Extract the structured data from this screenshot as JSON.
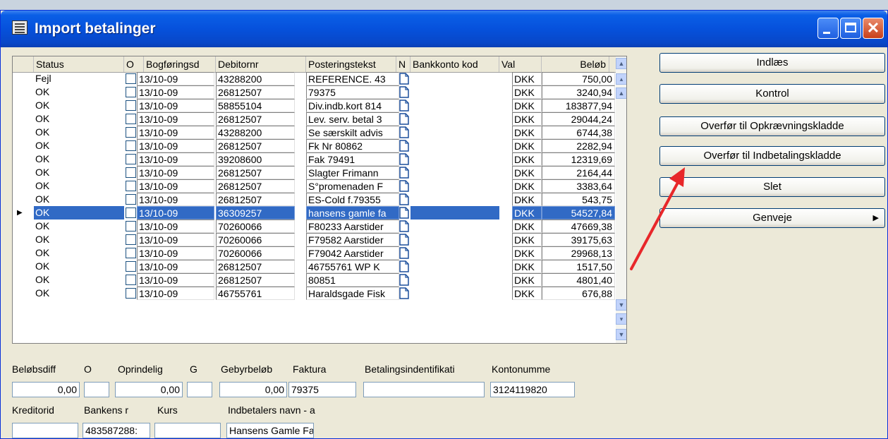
{
  "window": {
    "title": "Import betalinger"
  },
  "grid": {
    "columns": [
      "Status",
      "O",
      "Bogføringsd",
      "Debitornr",
      "Posteringstekst",
      "N",
      "Bankkonto kod",
      "Val",
      "Beløb"
    ],
    "rows": [
      {
        "status": "Fejl",
        "date": "13/10-09",
        "debitor": "43288200",
        "text": "REFERENCE. 43",
        "val": "DKK",
        "amount": "750,00"
      },
      {
        "status": "OK",
        "date": "13/10-09",
        "debitor": "26812507",
        "text": "79375",
        "val": "DKK",
        "amount": "3240,94"
      },
      {
        "status": "OK",
        "date": "13/10-09",
        "debitor": "58855104",
        "text": "Div.indb.kort 814",
        "val": "DKK",
        "amount": "183877,94"
      },
      {
        "status": "OK",
        "date": "13/10-09",
        "debitor": "26812507",
        "text": "Lev. serv. betal 3",
        "val": "DKK",
        "amount": "29044,24"
      },
      {
        "status": "OK",
        "date": "13/10-09",
        "debitor": "43288200",
        "text": "Se særskilt advis",
        "val": "DKK",
        "amount": "6744,38"
      },
      {
        "status": "OK",
        "date": "13/10-09",
        "debitor": "26812507",
        "text": "Fk Nr 80862",
        "val": "DKK",
        "amount": "2282,94"
      },
      {
        "status": "OK",
        "date": "13/10-09",
        "debitor": "39208600",
        "text": "Fak 79491",
        "val": "DKK",
        "amount": "12319,69"
      },
      {
        "status": "OK",
        "date": "13/10-09",
        "debitor": "26812507",
        "text": "Slagter Frimann",
        "val": "DKK",
        "amount": "2164,44"
      },
      {
        "status": "OK",
        "date": "13/10-09",
        "debitor": "26812507",
        "text": "S°promenaden F",
        "val": "DKK",
        "amount": "3383,64"
      },
      {
        "status": "OK",
        "date": "13/10-09",
        "debitor": "26812507",
        "text": "ES-Cold f.79355",
        "val": "DKK",
        "amount": "543,75"
      },
      {
        "status": "OK",
        "date": "13/10-09",
        "debitor": "36309257",
        "text": "hansens gamle fa",
        "val": "DKK",
        "amount": "54527,84",
        "selected": true
      },
      {
        "status": "OK",
        "date": "13/10-09",
        "debitor": "70260066",
        "text": "F80233 Aarstider",
        "val": "DKK",
        "amount": "47669,38"
      },
      {
        "status": "OK",
        "date": "13/10-09",
        "debitor": "70260066",
        "text": "F79582 Aarstider",
        "val": "DKK",
        "amount": "39175,63"
      },
      {
        "status": "OK",
        "date": "13/10-09",
        "debitor": "70260066",
        "text": "F79042 Aarstider",
        "val": "DKK",
        "amount": "29968,13"
      },
      {
        "status": "OK",
        "date": "13/10-09",
        "debitor": "26812507",
        "text": "46755761 WP K",
        "val": "DKK",
        "amount": "1517,50"
      },
      {
        "status": "OK",
        "date": "13/10-09",
        "debitor": "26812507",
        "text": "80851",
        "val": "DKK",
        "amount": "4801,40"
      },
      {
        "status": "OK",
        "date": "13/10-09",
        "debitor": "46755761",
        "text": "Haraldsgade Fisk",
        "val": "DKK",
        "amount": "676,88"
      }
    ]
  },
  "buttons": {
    "indlaes": "Indlæs",
    "kontrol": "Kontrol",
    "opkraevning": "Overfør til Opkrævningskladde",
    "indbetaling": "Overfør til Indbetalingskladde",
    "slet": "Slet",
    "genveje": "Genveje"
  },
  "detail": {
    "labels": {
      "belobsdiff": "Beløbsdiff",
      "o": "O",
      "oprindelig": "Oprindelig",
      "g": "G",
      "gebyrbelob": "Gebyrbeløb",
      "faktura": "Faktura",
      "betalingsid": "Betalingsindentifikati",
      "kontonummer": "Kontonumme",
      "kreditorid": "Kreditorid",
      "bankens": "Bankens r",
      "kurs": "Kurs",
      "indbetaler": "Indbetalers navn - a"
    },
    "values": {
      "belobsdiff": "0,00",
      "o": "",
      "oprindelig": "0,00",
      "g": "",
      "gebyrbelob": "0,00",
      "faktura": "79375",
      "betalingsid": "",
      "kontonummer": "3124119820",
      "kreditorid": "",
      "bankens": "483587288:",
      "kurs": "",
      "indbetaler": "Hansens Gamle Famili"
    }
  },
  "colors": {
    "selection": "#316ac5",
    "titlebar": "#0651dc",
    "arrow": "#e8272a"
  }
}
